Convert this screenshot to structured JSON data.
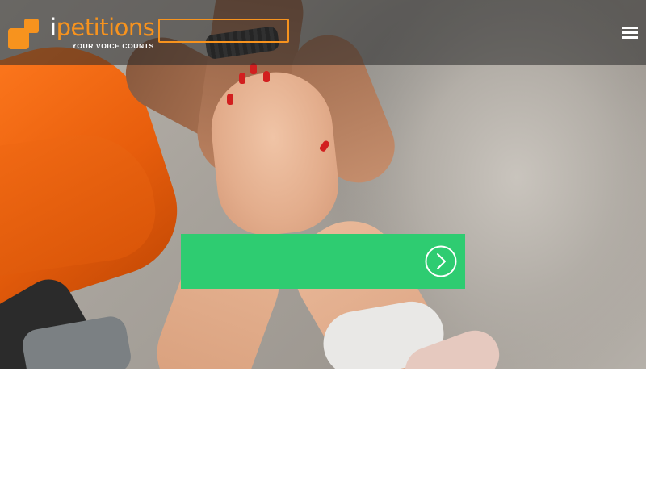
{
  "header": {
    "logo": {
      "wordmark_first": "i",
      "wordmark_rest": "petitions",
      "tagline": "YOUR VOICE COUNTS"
    },
    "outline_button_label": "",
    "menu_icon": "hamburger-menu-icon"
  },
  "hero": {
    "image": "stacked-hands-photo",
    "cta": {
      "label": "",
      "icon": "chevron-right-circle-icon"
    }
  },
  "colors": {
    "brand_orange": "#f7931e",
    "cta_green": "#2ecc71",
    "header_overlay": "rgba(40,40,40,0.55)",
    "white": "#ffffff"
  }
}
